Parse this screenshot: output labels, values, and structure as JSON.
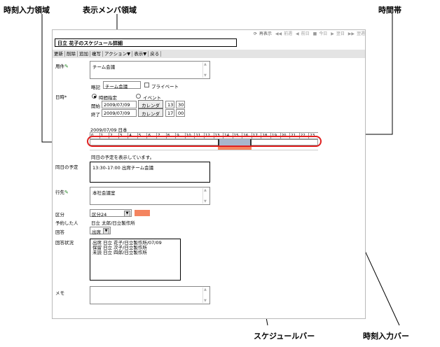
{
  "callouts": {
    "time_input_area": "時刻入力領域",
    "display_member_area": "表示メンバ領域",
    "time_zone": "時間帯",
    "schedule_bar": "スケジュールバー",
    "time_input_bar": "時刻入力バー"
  },
  "topnav": {
    "redisplay": "再表示",
    "prev_week": "前週",
    "prev_day": "前日",
    "today": "今日",
    "next_day": "翌日",
    "next_week": "翌週"
  },
  "title": "日立 花子のスケジュール詳細",
  "toolbar": {
    "update": "更新",
    "delete": "削除",
    "add": "追加",
    "copy": "複写",
    "action": "アクション▼",
    "view": "表示▼",
    "back": "戻る"
  },
  "form": {
    "subject_label": "用件",
    "subject_value": "チーム会議",
    "abbr_label": "略記",
    "abbr_value": "チーム会議",
    "private_label": "プライベート",
    "datetime_label": "日時",
    "required_mark": "*",
    "time_specified_label": "時間指定",
    "event_label": "イベント",
    "start_label": "開始",
    "start_date": "2009/07/09",
    "start_hour": "13",
    "start_min": "30",
    "end_label": "終了",
    "end_date": "2009/07/09",
    "end_hour": "17",
    "end_min": "00",
    "calendar_btn": "カレンダ",
    "timeline_date": "2009/07/09 日本",
    "hours": [
      "0",
      "1",
      "2",
      "3",
      "4",
      "5",
      "6",
      "7",
      "8",
      "9",
      "10",
      "11",
      "12",
      "13",
      "14",
      "15",
      "16",
      "17",
      "18",
      "19",
      "20",
      "21",
      "22",
      "23"
    ],
    "schedule_bar_start": 13.5,
    "schedule_bar_end": 17.0,
    "timeline_note": "同日の予定を表示しています。",
    "same_day_label": "同日の予定",
    "same_day_value": "13:30-17:00 出席チーム会議",
    "destination_label": "行先",
    "destination_value": "本社会議室",
    "category_label": "区分",
    "category_value": "区分24",
    "category_color": "#f4845f",
    "reserved_by_label": "予約した人",
    "reserved_by_value": "日立 太郎/日立製作所",
    "answer_label": "回答",
    "answer_value": "出席",
    "answer_status_label": "回答状況",
    "answer_status_lines": [
      "出席 日立 花子/日立製作所/07/09",
      "保留 日立 次子/日立製作所",
      "未読 日立 四郎/日立製作所"
    ],
    "memo_label": "メモ"
  },
  "colors": {
    "highlight_red": "#e02020",
    "bar_blue": "#a8b6cc",
    "bar_orange": "#f4845f"
  }
}
